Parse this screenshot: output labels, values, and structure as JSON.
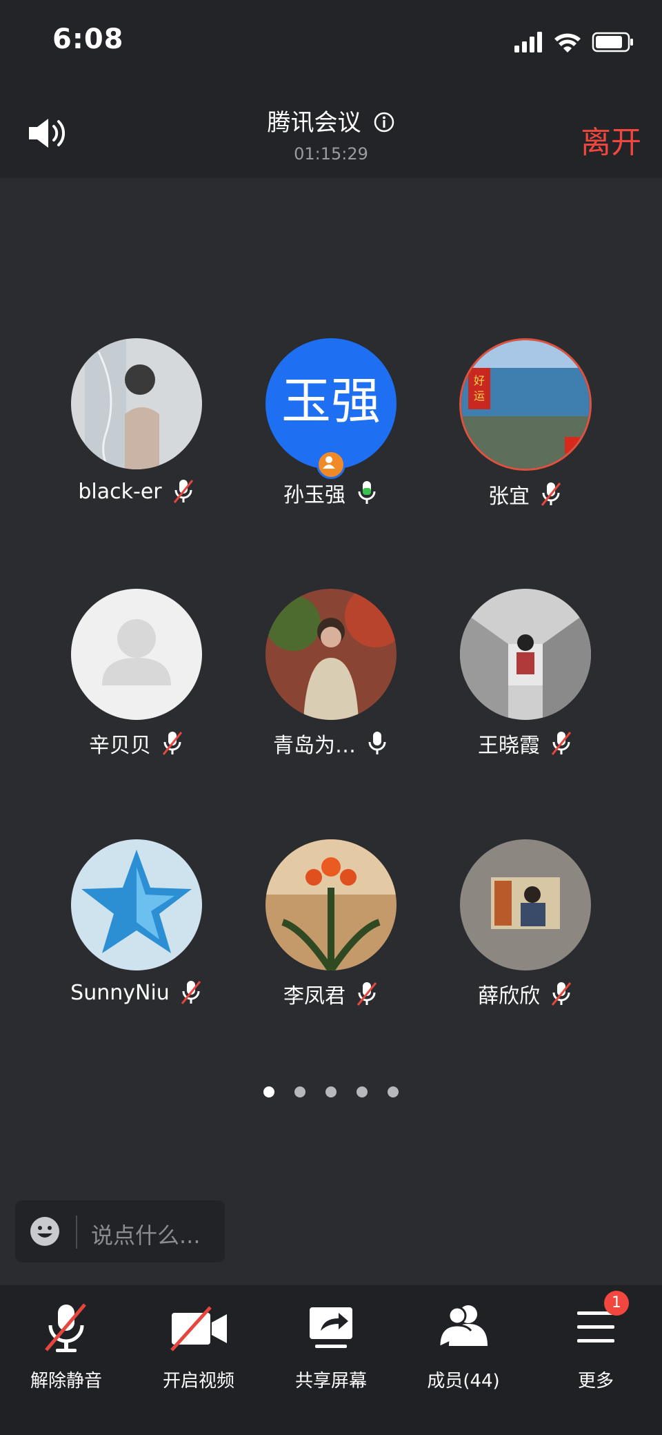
{
  "status_bar": {
    "time": "6:08"
  },
  "header": {
    "title": "腾讯会议",
    "timer": "01:15:29",
    "leave_label": "离开"
  },
  "participants": [
    {
      "name": "black-er",
      "mic": "muted",
      "avatar": "photo-woman-profile"
    },
    {
      "name": "孙玉强",
      "mic": "speaking",
      "avatar_text": "玉强",
      "avatar_color": "#1e6ff1",
      "host": true
    },
    {
      "name": "张宜",
      "mic": "muted",
      "avatar": "photo-lake-good-luck"
    },
    {
      "name": "辛贝贝",
      "mic": "muted",
      "avatar": "default-person"
    },
    {
      "name": "青岛为…",
      "mic": "on",
      "avatar": "photo-woman-garden"
    },
    {
      "name": "王晓霞",
      "mic": "muted",
      "avatar": "sketch-street"
    },
    {
      "name": "SunnyNiu",
      "mic": "muted",
      "avatar": "blue-glass-star"
    },
    {
      "name": "李凤君",
      "mic": "muted",
      "avatar": "photo-flower"
    },
    {
      "name": "薛欣欣",
      "mic": "muted",
      "avatar": "photo-frame"
    }
  ],
  "pagination": {
    "pages": 5,
    "current": 1
  },
  "chat": {
    "placeholder": "说点什么..."
  },
  "toolbar": {
    "unmute_label": "解除静音",
    "video_label": "开启视频",
    "share_label": "共享屏幕",
    "members_label": "成员(44)",
    "more_label": "更多",
    "more_badge": "1"
  },
  "colors": {
    "leave": "#f2473f",
    "accent": "#1e6ff1",
    "speaking": "#39c24d",
    "muted_slash": "#e5473f",
    "background": "#2a2c30"
  }
}
